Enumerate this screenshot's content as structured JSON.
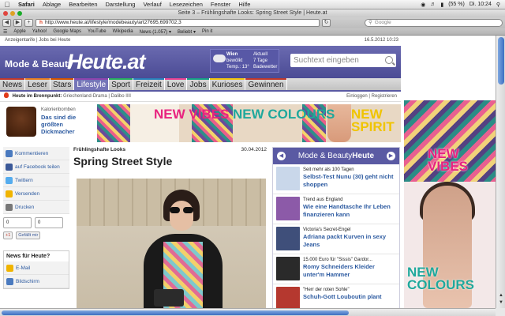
{
  "os_menu": {
    "app": "Safari",
    "items": [
      "Ablage",
      "Bearbeiten",
      "Darstellung",
      "Verlauf",
      "Lesezeichen",
      "Fenster",
      "Hilfe"
    ],
    "battery": "(55 %)",
    "clock": "Di. 10:24"
  },
  "window": {
    "title": "Seite 3 – Frühlingshafte Looks: Spring Street Style | Heute.at"
  },
  "toolbar": {
    "url": "http://www.heute.at/lifestyle/modebeauty/art27695,699702,3",
    "search_placeholder": "Google"
  },
  "bookmarks": [
    "Apple",
    "Yahoo!",
    "Google Maps",
    "YouTube",
    "Wikipedia",
    "News (1.057) ▾",
    "Beliebt ▾",
    "Pin it"
  ],
  "site": {
    "topstrip_left": "Anzeigentarife | Jobs bei Heute",
    "topstrip_right": "16.5.2012 10:23",
    "logo_small": "Mode & Beauty",
    "logo_big": "Heute.at",
    "weather": {
      "city": "Wien",
      "condition": "bewölkt",
      "temp": "Temp.: 13°",
      "label": "Aktuell",
      "days": "7 Tage",
      "sub": "Badewetter"
    },
    "search_placeholder": "Suchtext eingeben"
  },
  "nav": [
    {
      "label": "News",
      "color": "#c0392b"
    },
    {
      "label": "Leser",
      "color": "#e67e22"
    },
    {
      "label": "Stars",
      "color": "#d35400"
    },
    {
      "label": "Lifestyle",
      "color": "#8e44ad",
      "active": true
    },
    {
      "label": "Sport",
      "color": "#27ae60"
    },
    {
      "label": "Freizeit",
      "color": "#2980b9"
    },
    {
      "label": "Love",
      "color": "#e84393"
    },
    {
      "label": "Jobs",
      "color": "#16a085"
    },
    {
      "label": "Kurioses",
      "color": "#f1c40f"
    },
    {
      "label": "Gewinnen",
      "color": "#c0392b"
    }
  ],
  "brennpunkt": {
    "label": "Heute im Brennpunkt:",
    "links": "Griechenland-Drama | Dalibo IIII",
    "right": "Einloggen | Registrieren"
  },
  "promo": {
    "line1": "Kalorienbomben",
    "line2": "Das sind die größten Dickmacher"
  },
  "banner": {
    "vibes": "NEW VIBES",
    "colours": "NEW COLOURS",
    "spirit": "NEW SPIRIT"
  },
  "skyscraper": {
    "vibes": "NEW VIBES",
    "colours": "NEW COLOURS"
  },
  "left_actions": [
    {
      "label": "Kommentieren",
      "color": "#4a7abf"
    },
    {
      "label": "auf Facebook teilen",
      "color": "#3b5998"
    },
    {
      "label": "Twittern",
      "color": "#55acee"
    },
    {
      "label": "Versenden",
      "color": "#f0b400"
    },
    {
      "label": "Drucken",
      "color": "#777"
    }
  ],
  "counters": [
    "0",
    "0"
  ],
  "share_buttons": [
    "+1",
    "Gefällt mir"
  ],
  "newsbox": {
    "title": "News für Heute?",
    "items": [
      {
        "label": "E-Mail",
        "color": "#f0b400"
      },
      {
        "label": "Bildschirm",
        "color": "#4a7abf"
      }
    ]
  },
  "article": {
    "kicker": "Frühlingshafte Looks",
    "date": "30.04.2012",
    "title": "Spring Street Style"
  },
  "sidebar_box": {
    "title_pre": "Mode & Beauty",
    "title_bold": "Heute",
    "items": [
      {
        "kicker": "Seit mehr als 100 Tagen",
        "headline": "Selbst-Test Nunu (30) geht nicht shoppen",
        "color": "#c9d7ea"
      },
      {
        "kicker": "Trend aus England",
        "headline": "Wie eine Handtasche Ihr Leben finanzieren kann",
        "color": "#8c5aa8"
      },
      {
        "kicker": "Victoria's Secret-Engel",
        "headline": "Adriana packt Kurven in sexy Jeans",
        "color": "#3f4f7a"
      },
      {
        "kicker": "15.000 Euro für \"Sissis\" Gardor...",
        "headline": "Romy Schneiders Kleider unter'm Hammer",
        "color": "#2a2a2a"
      },
      {
        "kicker": "\"Herr der roten Sohle\"",
        "headline": "Schuh-Gott Louboutin plant",
        "color": "#b5382f"
      }
    ]
  }
}
